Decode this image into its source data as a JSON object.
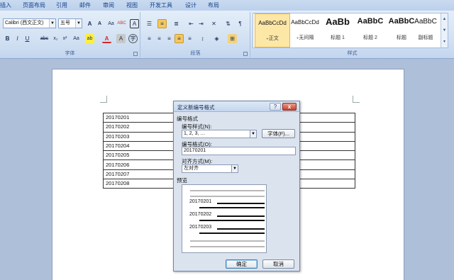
{
  "ribbon": {
    "tabs": [
      "插入",
      "页面布局",
      "引用",
      "邮件",
      "审阅",
      "视图",
      "开发工具",
      "设计",
      "布局"
    ],
    "font": {
      "font_name": "Calibri (西文正文)",
      "font_size": "五号",
      "group_label": "字体",
      "buttons_row1": [
        "A",
        "A",
        "Aa",
        "ABC",
        "A",
        "A"
      ],
      "buttons_row2": [
        "B",
        "I",
        "U",
        "abc",
        "x₂",
        "x²",
        "Aa",
        "ab",
        "A",
        "A",
        "字"
      ]
    },
    "paragraph": {
      "group_label": "段落"
    },
    "styles": {
      "group_label": "样式",
      "items": [
        {
          "sample": "AaBbCcDd",
          "name": "₊正文"
        },
        {
          "sample": "AaBbCcDd",
          "name": "₊无间隔"
        },
        {
          "sample": "AaBb",
          "name": "标题 1"
        },
        {
          "sample": "AaBbC",
          "name": "标题 2"
        },
        {
          "sample": "AaBbC",
          "name": "标题"
        },
        {
          "sample": "AaBbC",
          "name": "副标题"
        }
      ]
    }
  },
  "document": {
    "rows": [
      "20170201",
      "20170202",
      "20170203",
      "20170204",
      "20170205",
      "20170206",
      "20170207",
      "20170208"
    ]
  },
  "dialog": {
    "title": "定义新编号格式",
    "section_label": "编号格式",
    "style_label": "编号样式(N):",
    "style_value": "1, 2, 3, …",
    "font_button": "字体(F)...",
    "format_label": "编号格式(O):",
    "format_value": "20170201",
    "align_label": "对齐方式(M):",
    "align_value": "左对齐",
    "preview_label": "预览",
    "preview_items": [
      "20170201",
      "20170202",
      "20170203"
    ],
    "ok_label": "确定",
    "cancel_label": "取消",
    "help_glyph": "?",
    "close_glyph": "x"
  }
}
